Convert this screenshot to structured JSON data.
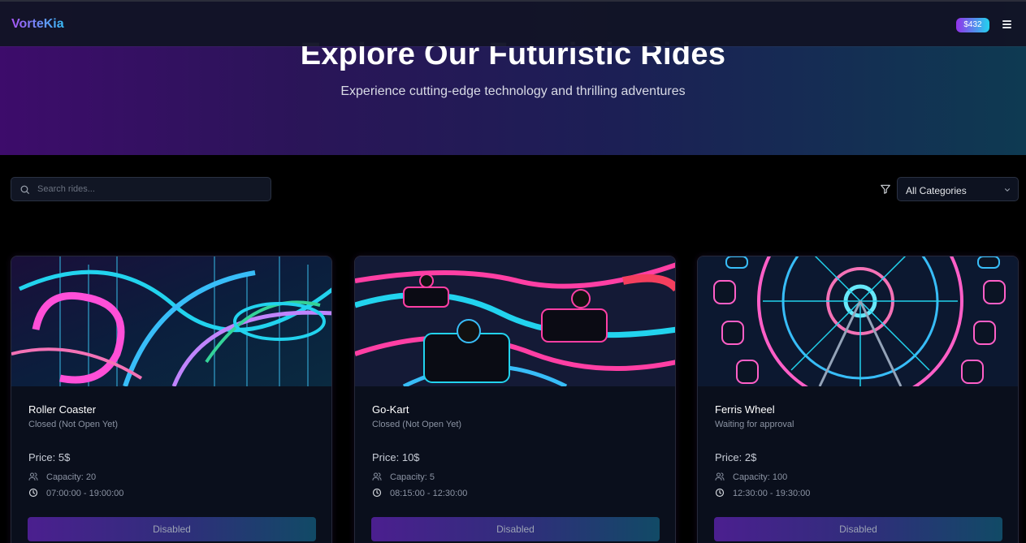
{
  "nav": {
    "brand": "VorteKia",
    "balance": "$432",
    "menu_icon": "hamburger-menu-icon",
    "colors": {
      "brand_from": "#a855f7",
      "brand_to": "#38bdf8"
    }
  },
  "hero": {
    "title": "Explore Our Futuristic Rides",
    "subtitle": "Experience cutting-edge technology and thrilling adventures"
  },
  "toolbar": {
    "search_placeholder": "Search rides...",
    "search_value": "",
    "category_selected": "All Categories",
    "filter_icon": "filter-funnel-icon"
  },
  "rides": [
    {
      "name": "Roller Coaster",
      "status": "Closed (Not Open Yet)",
      "price": "Price: 5$",
      "capacity": "Capacity: 20",
      "hours": "07:00:00 - 19:00:00",
      "button": "Disabled"
    },
    {
      "name": "Go-Kart",
      "status": "Closed (Not Open Yet)",
      "price": "Price: 10$",
      "capacity": "Capacity: 5",
      "hours": "08:15:00 - 12:30:00",
      "button": "Disabled"
    },
    {
      "name": "Ferris Wheel",
      "status": "Waiting for approval",
      "price": "Price: 2$",
      "capacity": "Capacity: 100",
      "hours": "12:30:00 - 19:30:00",
      "button": "Disabled"
    }
  ],
  "accent": {
    "purple": "#9333ea",
    "cyan": "#22d3ee",
    "neon_pink": "#ff3fa4"
  }
}
